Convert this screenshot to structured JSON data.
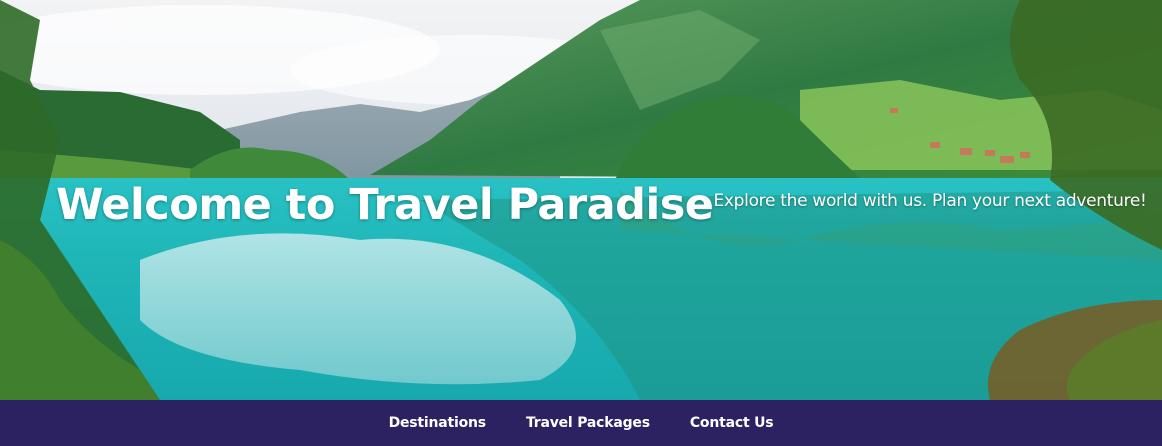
{
  "hero": {
    "title": "Welcome to Travel Paradise",
    "subtitle": "Explore the world with us. Plan your next adventure!",
    "image_description": "alpine-lake-landscape"
  },
  "nav": {
    "background": "#2c2262",
    "links": [
      {
        "label": "Destinations"
      },
      {
        "label": "Travel Packages"
      },
      {
        "label": "Contact Us"
      }
    ]
  },
  "colors": {
    "sky": "#eef1f4",
    "lake": "#2bbcc0",
    "mountain_green": "#3e8a4a",
    "nav_text": "#ffffff"
  }
}
